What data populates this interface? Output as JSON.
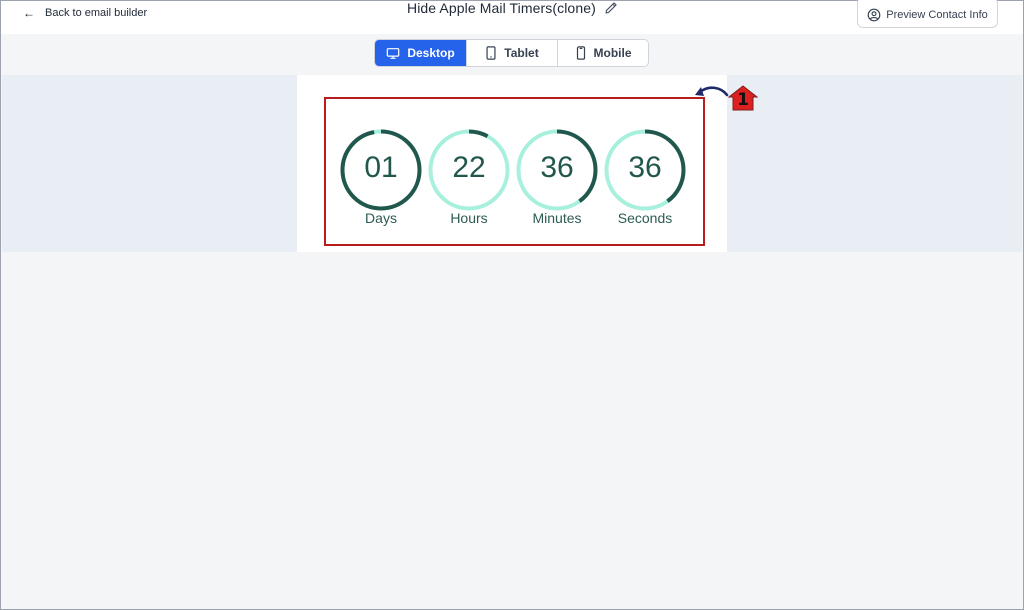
{
  "header": {
    "back_label": "Back to email builder",
    "title": "Hide Apple Mail Timers(clone)",
    "preview_label": "Preview Contact Info"
  },
  "device_toggle": {
    "options": [
      {
        "label": "Desktop",
        "icon": "desktop-icon",
        "active": true
      },
      {
        "label": "Tablet",
        "icon": "tablet-icon",
        "active": false
      },
      {
        "label": "Mobile",
        "icon": "mobile-icon",
        "active": false
      }
    ]
  },
  "timer": {
    "units": [
      {
        "value": "01",
        "label": "Days",
        "progress": 0.97
      },
      {
        "value": "22",
        "label": "Hours",
        "progress": 0.08
      },
      {
        "value": "36",
        "label": "Minutes",
        "progress": 0.4
      },
      {
        "value": "36",
        "label": "Seconds",
        "progress": 0.4
      }
    ],
    "colors": {
      "ring_track": "#a7f0dd",
      "ring_fill": "#22574d",
      "text": "#22574d"
    }
  },
  "annotation": {
    "badge_number": "1",
    "highlight_color": "#b91c1c"
  },
  "colors": {
    "accent": "#2563eb",
    "band": "#e9eef5"
  }
}
